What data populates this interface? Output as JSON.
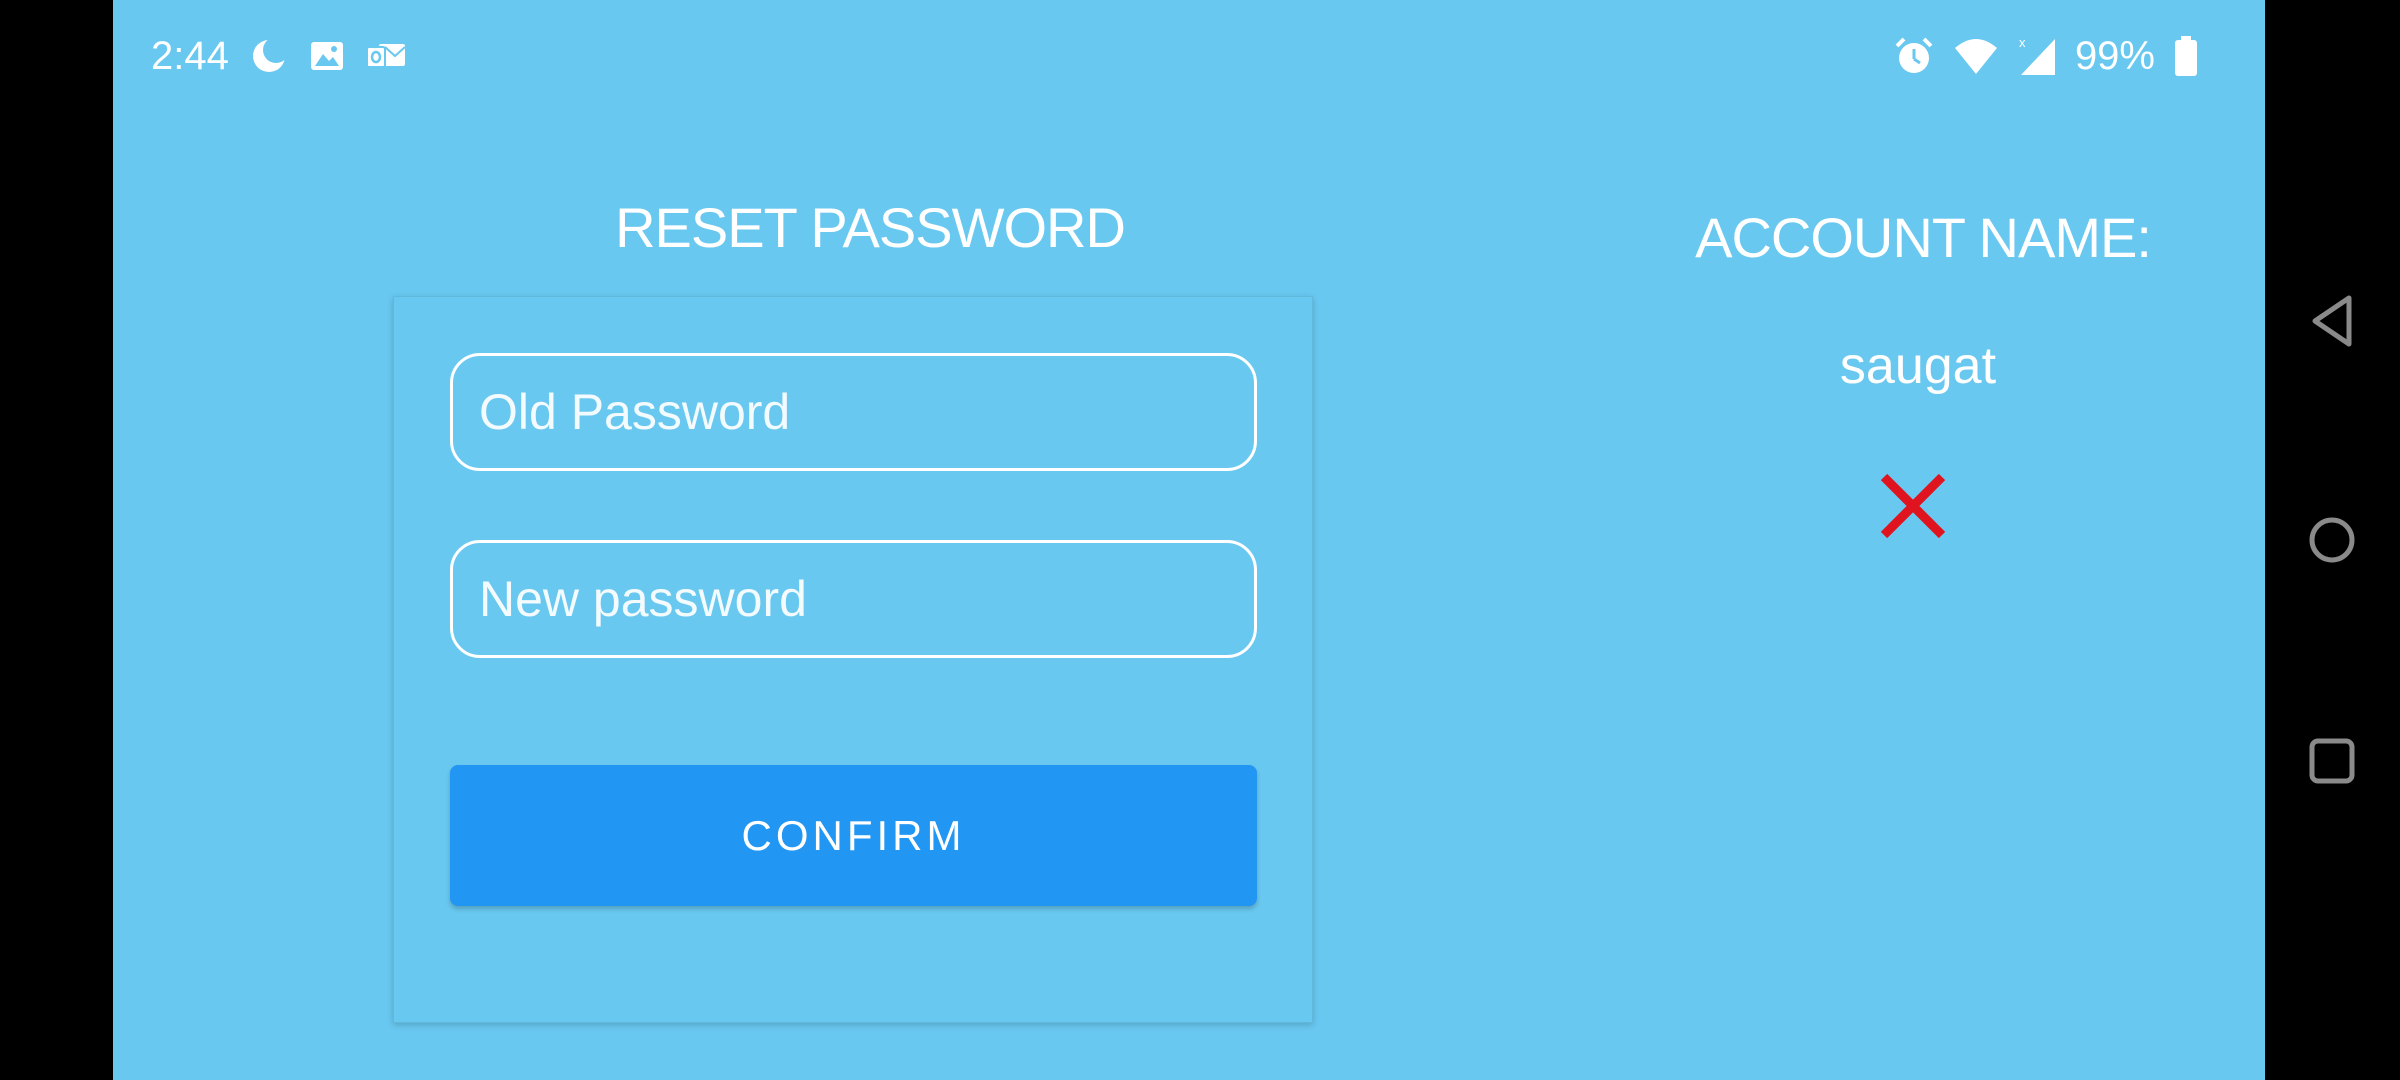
{
  "status_bar": {
    "time": "2:44",
    "battery": "99%",
    "left_icons": [
      "moon-icon",
      "image-icon",
      "outlook-icon"
    ],
    "right_icons": [
      "alarm-icon",
      "wifi-icon",
      "signal-icon",
      "battery-icon"
    ]
  },
  "reset": {
    "title": "RESET PASSWORD",
    "old_placeholder": "Old Password",
    "new_placeholder": "New password",
    "confirm_label": "CONFIRM"
  },
  "account": {
    "label": "ACCOUNT NAME:",
    "name": "saugat"
  },
  "colors": {
    "background": "#69c8f0",
    "button": "#2196f3",
    "close": "#e0141e"
  }
}
